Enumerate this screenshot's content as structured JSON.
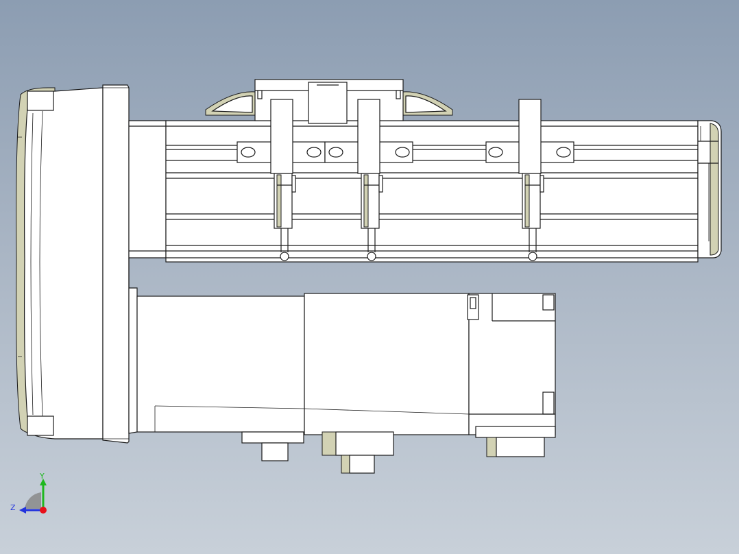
{
  "triad": {
    "y_label": "Y",
    "z_label": "Z",
    "colors": {
      "y": "#1fb81f",
      "z": "#2233dd",
      "x": "#e8101a"
    }
  },
  "colors": {
    "background_top": "#8c9db2",
    "background_bottom": "#c8d0d9",
    "edge": "#1a1a1a",
    "face": "#ffffff",
    "shade": "#d2d2b4"
  }
}
